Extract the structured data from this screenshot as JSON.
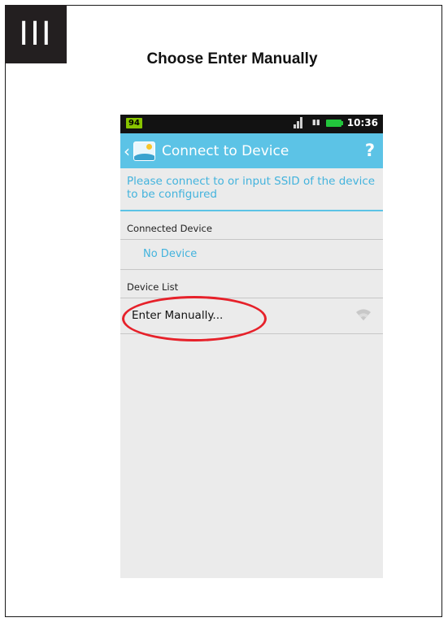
{
  "step_badge": "III",
  "instruction": "Choose Enter Manually",
  "phone": {
    "status_bar": {
      "app_badge": "94",
      "time": "10:36",
      "icons": [
        "signal-icon",
        "gsm-icon",
        "battery-icon"
      ]
    },
    "action_bar": {
      "back_icon": "‹",
      "title": "Connect to Device",
      "help_icon": "?"
    },
    "prompt": "Please connect to or input SSID of the device to be configured",
    "connected_section": {
      "header": "Connected Device",
      "value": "No Device"
    },
    "device_list_section": {
      "header": "Device List",
      "items": [
        {
          "label": "Enter Manually...",
          "icon": "wifi-icon"
        }
      ]
    }
  },
  "colors": {
    "accent": "#5cc3e6",
    "link_text": "#43b3dd",
    "highlight": "#e6212a",
    "badge_bg": "#231f20"
  }
}
